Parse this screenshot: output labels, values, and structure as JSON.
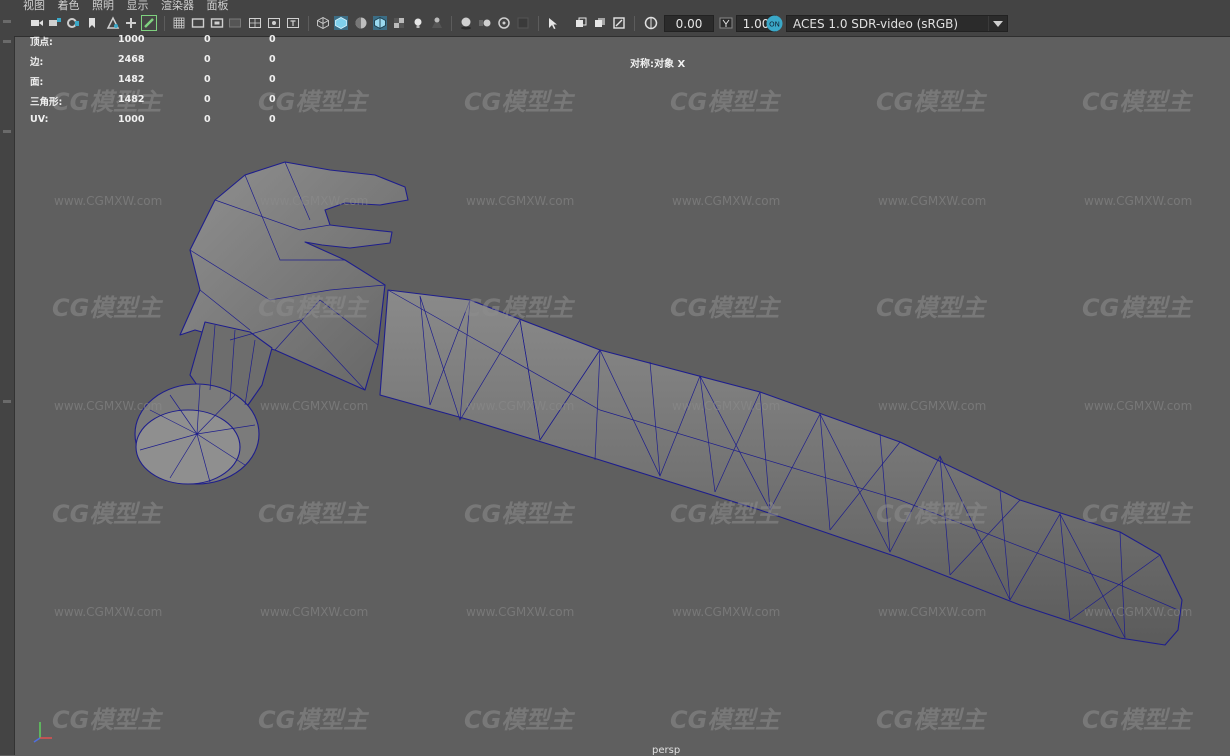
{
  "menu": {
    "items": [
      "视图",
      "着色",
      "照明",
      "显示",
      "渲染器",
      "面板"
    ]
  },
  "toolbar": {
    "exposure": "0.00",
    "gamma": "1.00",
    "color_space": "ACES 1.0 SDR-video (sRGB)",
    "icons": [
      "camera-select-icon",
      "camera-attributes-icon",
      "bookmark-icon",
      "image-plane-icon",
      "grid-icon",
      "film-gate-icon",
      "resolution-gate-icon",
      "gate-mask-icon",
      "field-chart-icon",
      "safe-action-icon",
      "safe-title-icon",
      "wireframe-icon",
      "smooth-shade-icon",
      "wireframe-on-shaded-icon",
      "textured-icon",
      "use-all-lights-icon",
      "shadows-icon",
      "ambient-occlusion-icon",
      "motion-blur-icon",
      "anti-aliasing-icon",
      "isolate-select-icon",
      "xray-icon",
      "xray-joints-icon",
      "backface-icon",
      "exposure-icon",
      "gamma-icon",
      "color-management-icon"
    ]
  },
  "hud": {
    "rows": [
      {
        "label": "顶点:",
        "v1": "1000",
        "v2": "0",
        "v3": "0"
      },
      {
        "label": "边:",
        "v1": "2468",
        "v2": "0",
        "v3": "0"
      },
      {
        "label": "面:",
        "v1": "1482",
        "v2": "0",
        "v3": "0"
      },
      {
        "label": "三角形:",
        "v1": "1482",
        "v2": "0",
        "v3": "0"
      },
      {
        "label": "UV:",
        "v1": "1000",
        "v2": "0",
        "v3": "0"
      }
    ],
    "symmetry": "对称:对象 X"
  },
  "viewport": {
    "camera": "persp",
    "background": "#5f5f5f",
    "wire_color": "#1e1e8c"
  },
  "watermark": {
    "logo": "CG模型主",
    "url": "www.CGMXW.com"
  },
  "colors": {
    "ui_dark": "#444444",
    "field_bg": "#2b2b2b",
    "accent": "#3aa8c8"
  }
}
